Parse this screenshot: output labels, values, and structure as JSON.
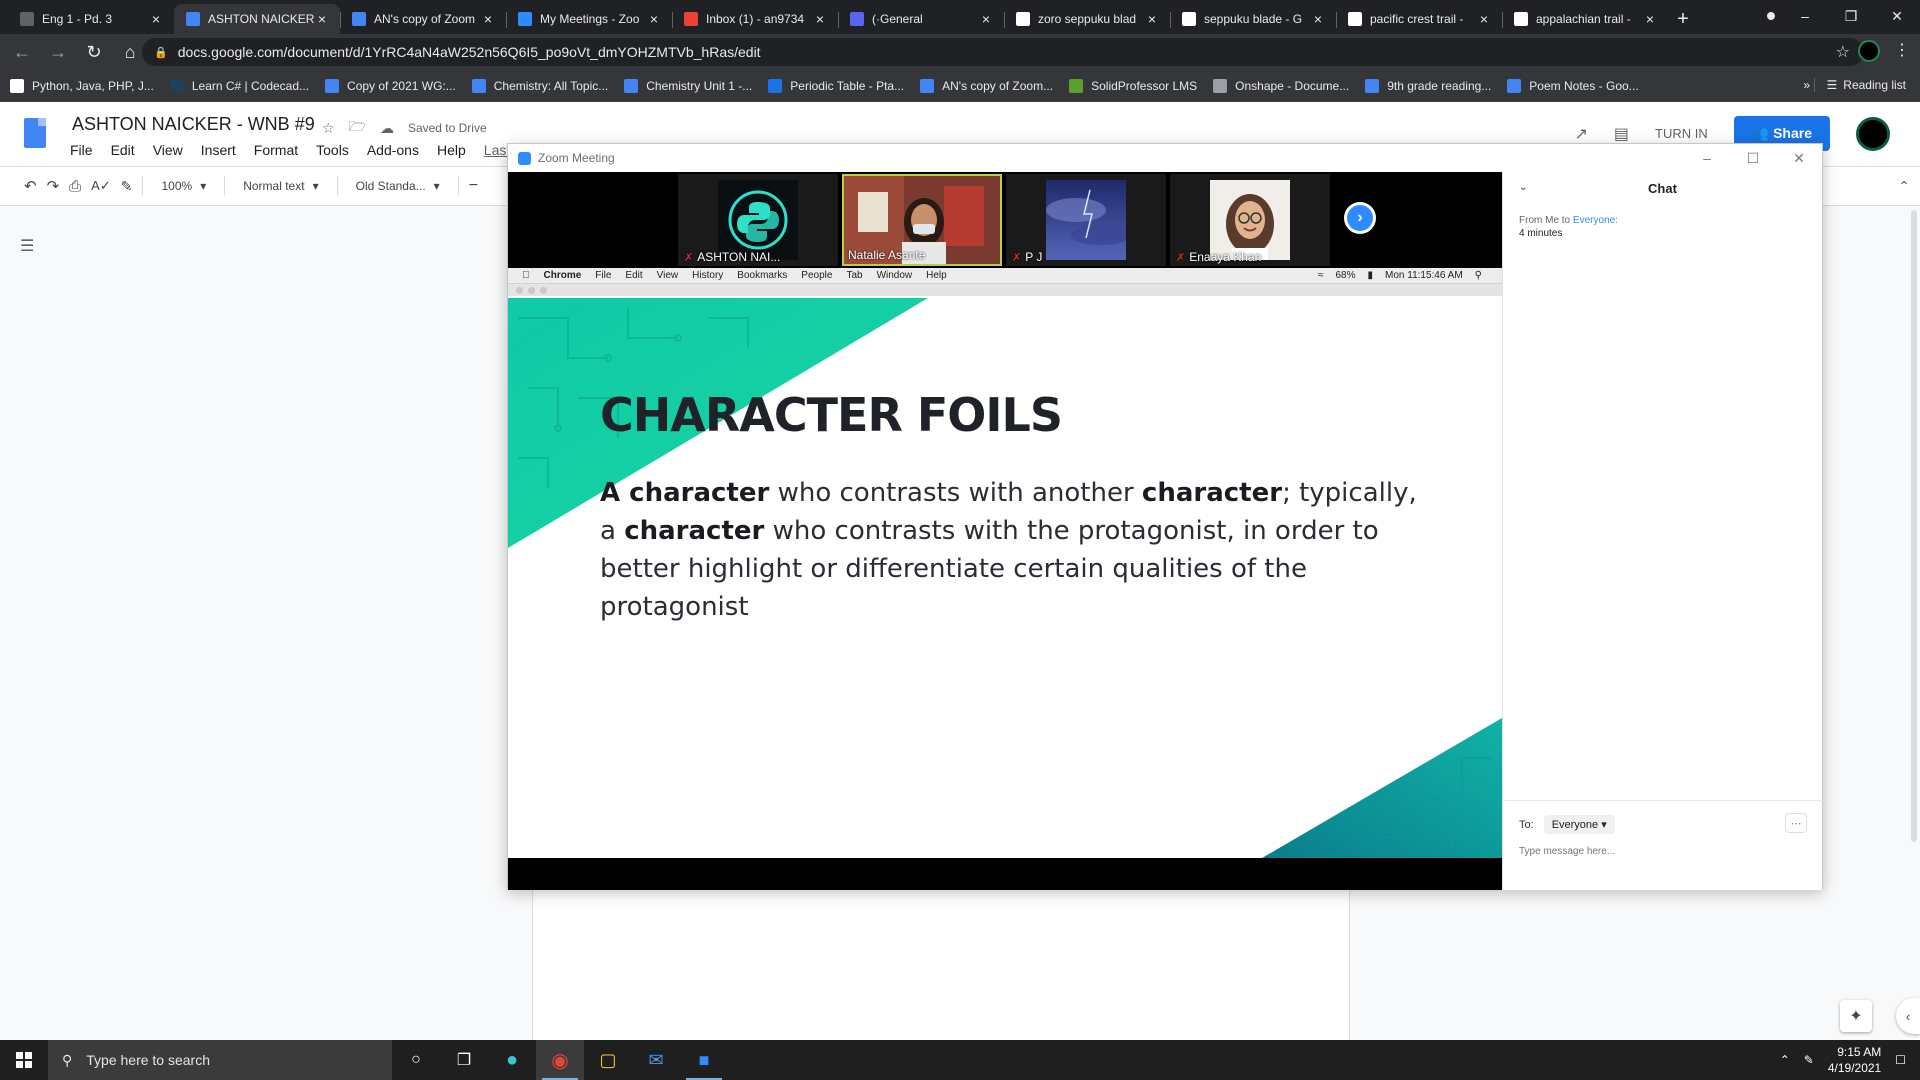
{
  "browser": {
    "tabs": [
      {
        "title": "Eng 1 - Pd. 3",
        "favicon_color": "#5f6368",
        "icon": "classroom-icon"
      },
      {
        "title": "ASHTON NAICKER",
        "favicon_color": "#4285f4",
        "icon": "docs-icon",
        "active": true
      },
      {
        "title": "AN's copy of Zoom",
        "favicon_color": "#4285f4",
        "icon": "docs-icon"
      },
      {
        "title": "My Meetings - Zoo",
        "favicon_color": "#2d8cff",
        "icon": "zoom-icon"
      },
      {
        "title": "Inbox (1) - an9734",
        "favicon_color": "#ea4335",
        "icon": "gmail-icon"
      },
      {
        "title": "(·General",
        "favicon_color": "#5865f2",
        "icon": "discord-icon"
      },
      {
        "title": "zoro seppuku blad",
        "favicon_color": "#ffffff",
        "icon": "google-icon"
      },
      {
        "title": "seppuku blade - G",
        "favicon_color": "#ffffff",
        "icon": "google-icon"
      },
      {
        "title": "pacific crest trail -",
        "favicon_color": "#ffffff",
        "icon": "google-icon"
      },
      {
        "title": "appalachian trail -",
        "favicon_color": "#ffffff",
        "icon": "google-icon"
      }
    ],
    "url": "docs.google.com/document/d/1YrRC4aN4aW252n56Q6I5_po9oVt_dmYOHZMTVb_hRas/edit",
    "bookmarks": [
      {
        "label": "Python, Java, PHP, J...",
        "color": "#ffffff"
      },
      {
        "label": "Learn C# | Codecad...",
        "color": "#1f4056"
      },
      {
        "label": "Copy of 2021 WG:...",
        "color": "#4285f4"
      },
      {
        "label": "Chemistry: All Topic...",
        "color": "#4285f4"
      },
      {
        "label": "Chemistry Unit 1 -...",
        "color": "#4285f4"
      },
      {
        "label": "Periodic Table - Pta...",
        "color": "#1a73e8"
      },
      {
        "label": "AN's copy of Zoom...",
        "color": "#4285f4"
      },
      {
        "label": "SolidProfessor LMS",
        "color": "#5aa02c"
      },
      {
        "label": "Onshape - Docume...",
        "color": "#9aa0a6"
      },
      {
        "label": "9th grade reading...",
        "color": "#4285f4"
      },
      {
        "label": "Poem Notes - Goo...",
        "color": "#4285f4"
      }
    ],
    "bookmarks_more": "»",
    "reading_list": "Reading list"
  },
  "docs": {
    "title": "ASHTON NAICKER - WNB #9",
    "saved": "Saved to Drive",
    "menus": [
      "File",
      "Edit",
      "View",
      "Insert",
      "Format",
      "Tools",
      "Add-ons",
      "Help"
    ],
    "last_edit": "Last e",
    "turn_in": "TURN IN",
    "share": "Share",
    "zoom_level": "100%",
    "style": "Normal text",
    "font": "Old Standa..."
  },
  "zoom": {
    "window_title": "Zoom Meeting",
    "participants": [
      {
        "name": "ASHTON NAI...",
        "muted": true
      },
      {
        "name": "Natalie Asante",
        "muted": false,
        "speaking": true
      },
      {
        "name": "P J",
        "muted": true
      },
      {
        "name": "Enaaya Khan",
        "muted": true
      }
    ],
    "shared_screen": {
      "menu_app": "Chrome",
      "menu_items": [
        "File",
        "Edit",
        "View",
        "History",
        "Bookmarks",
        "People",
        "Tab",
        "Window",
        "Help"
      ],
      "battery": "68%",
      "clock": "Mon 11:15:46 AM"
    },
    "slide": {
      "title": "CHARACTER FOILS",
      "body": [
        {
          "text": "A character",
          "bold": true
        },
        {
          "text": " who contrasts with another ",
          "bold": false
        },
        {
          "text": "character",
          "bold": true
        },
        {
          "text": "; typically, a ",
          "bold": false
        },
        {
          "text": "character",
          "bold": true
        },
        {
          "text": " who contrasts with the protagonist, in order to better highlight or differentiate certain qualities of the protagonist",
          "bold": false
        }
      ]
    },
    "chat": {
      "header": "Chat",
      "message_from": "From Me to",
      "message_to": "Everyone:",
      "message_time": "4 minutes",
      "to_label": "To:",
      "recipient": "Everyone",
      "placeholder": "Type message here..."
    }
  },
  "taskbar": {
    "search_placeholder": "Type here to search",
    "time": "9:15 AM",
    "date": "4/19/2021"
  }
}
